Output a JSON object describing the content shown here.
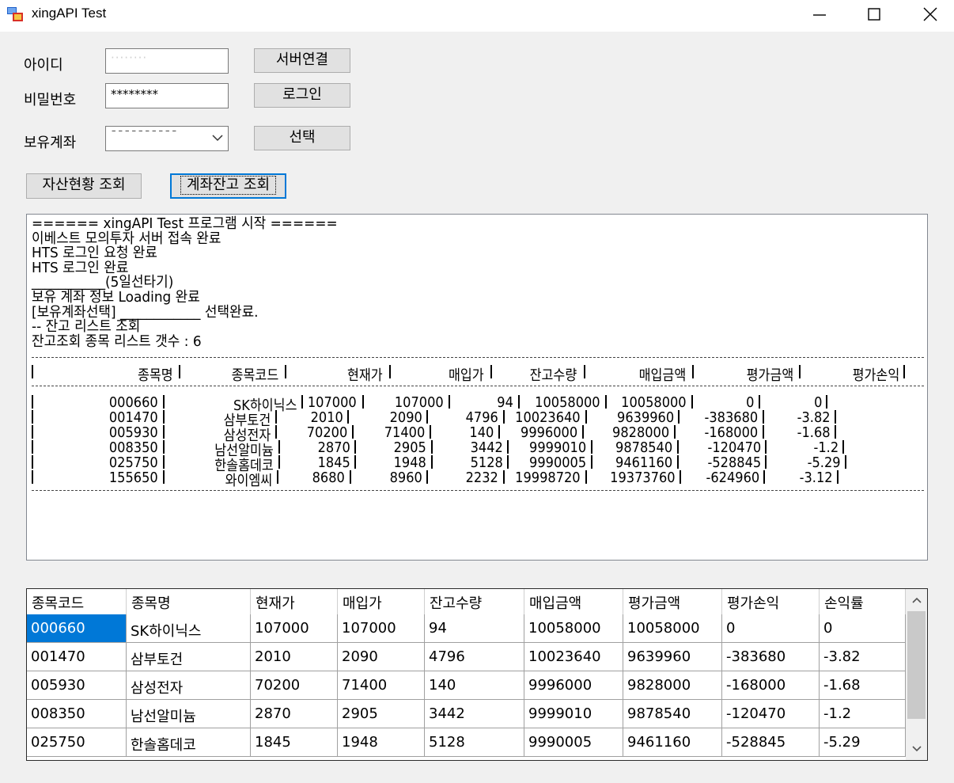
{
  "window": {
    "title": "xingAPI Test"
  },
  "form": {
    "id_label": "아이디",
    "id_value": "········",
    "password_label": "비밀번호",
    "password_value": "********",
    "account_label": "보유계좌",
    "account_value": "¯¯¯¯¯¯¯¯¯¯",
    "connect_button": "서버연결",
    "login_button": "로그인",
    "select_button": "선택",
    "asset_query_button": "자산현황 조회",
    "balance_query_button": "계좌잔고 조회"
  },
  "log": {
    "lines": [
      "====== xingAPI Test 프로그램 시작 ======",
      "이베스트 모의투자 서버 접속 완료",
      "HTS 로그인 요청 완료",
      "HTS 로그인 완료",
      "___________(5일선타기)",
      "보유 계좌 정보 Loading 완료",
      "[보유계좌선택] ____________ 선택완료.",
      "-- 잔고 리스트 조회",
      "잔고조회 종목 리스트 갯수 : 6"
    ],
    "headers": [
      "종목명",
      "종목코드",
      "현재가",
      "매입가",
      "잔고수량",
      "매입금액",
      "평가금액",
      "평가손익"
    ],
    "rows": [
      [
        "000660",
        "SK하이닉스",
        "107000",
        "107000",
        "94",
        "10058000",
        "10058000",
        "0",
        "0"
      ],
      [
        "001470",
        "삼부토건",
        "2010",
        "2090",
        "4796",
        "10023640",
        "9639960",
        "-383680",
        "-3.82"
      ],
      [
        "005930",
        "삼성전자",
        "70200",
        "71400",
        "140",
        "9996000",
        "9828000",
        "-168000",
        "-1.68"
      ],
      [
        "008350",
        "남선알미늄",
        "2870",
        "2905",
        "3442",
        "9999010",
        "9878540",
        "-120470",
        "-1.2"
      ],
      [
        "025750",
        "한솔홈데코",
        "1845",
        "1948",
        "5128",
        "9990005",
        "9461160",
        "-528845",
        "-5.29"
      ],
      [
        "155650",
        "와이엠씨",
        "8680",
        "8960",
        "2232",
        "19998720",
        "19373760",
        "-624960",
        "-3.12"
      ]
    ]
  },
  "grid": {
    "columns": [
      "종목코드",
      "종목명",
      "현재가",
      "매입가",
      "잔고수량",
      "매입금액",
      "평가금액",
      "평가손익",
      "손익률"
    ],
    "rows": [
      [
        "000660",
        "SK하이닉스",
        "107000",
        "107000",
        "94",
        "10058000",
        "10058000",
        "0",
        "0"
      ],
      [
        "001470",
        "삼부토건",
        "2010",
        "2090",
        "4796",
        "10023640",
        "9639960",
        "-383680",
        "-3.82"
      ],
      [
        "005930",
        "삼성전자",
        "70200",
        "71400",
        "140",
        "9996000",
        "9828000",
        "-168000",
        "-1.68"
      ],
      [
        "008350",
        "남선알미늄",
        "2870",
        "2905",
        "3442",
        "9999010",
        "9878540",
        "-120470",
        "-1.2"
      ],
      [
        "025750",
        "한솔홈데코",
        "1845",
        "1948",
        "5128",
        "9990005",
        "9461160",
        "-528845",
        "-5.29"
      ]
    ],
    "selected_cell": "000660"
  },
  "colors": {
    "selection": "#0078d7",
    "background": "#f0f0f0"
  }
}
